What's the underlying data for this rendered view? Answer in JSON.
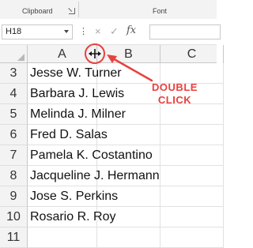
{
  "ribbon": {
    "clipboard_label": "Clipboard",
    "font_label": "Font"
  },
  "formula_bar": {
    "name_box": "H18",
    "more_icon": "vertical-ellipsis",
    "cancel_icon": "×",
    "enter_icon": "✓",
    "fx_label": "fx",
    "formula": ""
  },
  "columns": [
    "A",
    "B",
    "C"
  ],
  "rows": [
    {
      "num": "3",
      "a": "Jesse W. Turner"
    },
    {
      "num": "4",
      "a": "Barbara J. Lewis"
    },
    {
      "num": "5",
      "a": "Melinda J. Milner"
    },
    {
      "num": "6",
      "a": "Fred D. Salas"
    },
    {
      "num": "7",
      "a": "Pamela K. Costantino"
    },
    {
      "num": "8",
      "a": "Jacqueline J. Hermann"
    },
    {
      "num": "9",
      "a": "Jose S. Perkins"
    },
    {
      "num": "10",
      "a": "Rosario R. Roy"
    },
    {
      "num": "11",
      "a": ""
    }
  ],
  "annotation": {
    "line1": "DOUBLE",
    "line2": "CLICK",
    "color": "#e8413f"
  }
}
